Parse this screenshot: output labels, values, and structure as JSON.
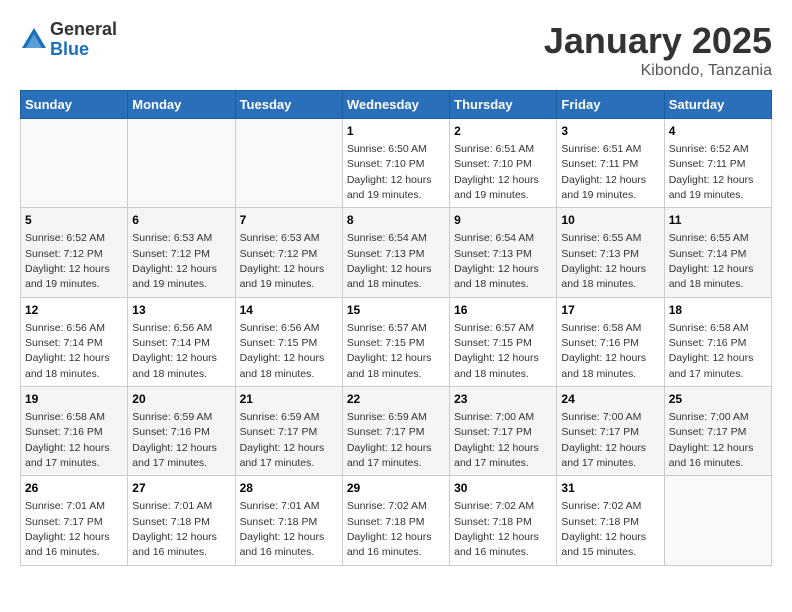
{
  "logo": {
    "general": "General",
    "blue": "Blue"
  },
  "title": "January 2025",
  "subtitle": "Kibondo, Tanzania",
  "headers": [
    "Sunday",
    "Monday",
    "Tuesday",
    "Wednesday",
    "Thursday",
    "Friday",
    "Saturday"
  ],
  "weeks": [
    [
      {
        "day": "",
        "info": ""
      },
      {
        "day": "",
        "info": ""
      },
      {
        "day": "",
        "info": ""
      },
      {
        "day": "1",
        "info": "Sunrise: 6:50 AM\nSunset: 7:10 PM\nDaylight: 12 hours and 19 minutes."
      },
      {
        "day": "2",
        "info": "Sunrise: 6:51 AM\nSunset: 7:10 PM\nDaylight: 12 hours and 19 minutes."
      },
      {
        "day": "3",
        "info": "Sunrise: 6:51 AM\nSunset: 7:11 PM\nDaylight: 12 hours and 19 minutes."
      },
      {
        "day": "4",
        "info": "Sunrise: 6:52 AM\nSunset: 7:11 PM\nDaylight: 12 hours and 19 minutes."
      }
    ],
    [
      {
        "day": "5",
        "info": "Sunrise: 6:52 AM\nSunset: 7:12 PM\nDaylight: 12 hours and 19 minutes."
      },
      {
        "day": "6",
        "info": "Sunrise: 6:53 AM\nSunset: 7:12 PM\nDaylight: 12 hours and 19 minutes."
      },
      {
        "day": "7",
        "info": "Sunrise: 6:53 AM\nSunset: 7:12 PM\nDaylight: 12 hours and 19 minutes."
      },
      {
        "day": "8",
        "info": "Sunrise: 6:54 AM\nSunset: 7:13 PM\nDaylight: 12 hours and 18 minutes."
      },
      {
        "day": "9",
        "info": "Sunrise: 6:54 AM\nSunset: 7:13 PM\nDaylight: 12 hours and 18 minutes."
      },
      {
        "day": "10",
        "info": "Sunrise: 6:55 AM\nSunset: 7:13 PM\nDaylight: 12 hours and 18 minutes."
      },
      {
        "day": "11",
        "info": "Sunrise: 6:55 AM\nSunset: 7:14 PM\nDaylight: 12 hours and 18 minutes."
      }
    ],
    [
      {
        "day": "12",
        "info": "Sunrise: 6:56 AM\nSunset: 7:14 PM\nDaylight: 12 hours and 18 minutes."
      },
      {
        "day": "13",
        "info": "Sunrise: 6:56 AM\nSunset: 7:14 PM\nDaylight: 12 hours and 18 minutes."
      },
      {
        "day": "14",
        "info": "Sunrise: 6:56 AM\nSunset: 7:15 PM\nDaylight: 12 hours and 18 minutes."
      },
      {
        "day": "15",
        "info": "Sunrise: 6:57 AM\nSunset: 7:15 PM\nDaylight: 12 hours and 18 minutes."
      },
      {
        "day": "16",
        "info": "Sunrise: 6:57 AM\nSunset: 7:15 PM\nDaylight: 12 hours and 18 minutes."
      },
      {
        "day": "17",
        "info": "Sunrise: 6:58 AM\nSunset: 7:16 PM\nDaylight: 12 hours and 18 minutes."
      },
      {
        "day": "18",
        "info": "Sunrise: 6:58 AM\nSunset: 7:16 PM\nDaylight: 12 hours and 17 minutes."
      }
    ],
    [
      {
        "day": "19",
        "info": "Sunrise: 6:58 AM\nSunset: 7:16 PM\nDaylight: 12 hours and 17 minutes."
      },
      {
        "day": "20",
        "info": "Sunrise: 6:59 AM\nSunset: 7:16 PM\nDaylight: 12 hours and 17 minutes."
      },
      {
        "day": "21",
        "info": "Sunrise: 6:59 AM\nSunset: 7:17 PM\nDaylight: 12 hours and 17 minutes."
      },
      {
        "day": "22",
        "info": "Sunrise: 6:59 AM\nSunset: 7:17 PM\nDaylight: 12 hours and 17 minutes."
      },
      {
        "day": "23",
        "info": "Sunrise: 7:00 AM\nSunset: 7:17 PM\nDaylight: 12 hours and 17 minutes."
      },
      {
        "day": "24",
        "info": "Sunrise: 7:00 AM\nSunset: 7:17 PM\nDaylight: 12 hours and 17 minutes."
      },
      {
        "day": "25",
        "info": "Sunrise: 7:00 AM\nSunset: 7:17 PM\nDaylight: 12 hours and 16 minutes."
      }
    ],
    [
      {
        "day": "26",
        "info": "Sunrise: 7:01 AM\nSunset: 7:17 PM\nDaylight: 12 hours and 16 minutes."
      },
      {
        "day": "27",
        "info": "Sunrise: 7:01 AM\nSunset: 7:18 PM\nDaylight: 12 hours and 16 minutes."
      },
      {
        "day": "28",
        "info": "Sunrise: 7:01 AM\nSunset: 7:18 PM\nDaylight: 12 hours and 16 minutes."
      },
      {
        "day": "29",
        "info": "Sunrise: 7:02 AM\nSunset: 7:18 PM\nDaylight: 12 hours and 16 minutes."
      },
      {
        "day": "30",
        "info": "Sunrise: 7:02 AM\nSunset: 7:18 PM\nDaylight: 12 hours and 16 minutes."
      },
      {
        "day": "31",
        "info": "Sunrise: 7:02 AM\nSunset: 7:18 PM\nDaylight: 12 hours and 15 minutes."
      },
      {
        "day": "",
        "info": ""
      }
    ]
  ]
}
